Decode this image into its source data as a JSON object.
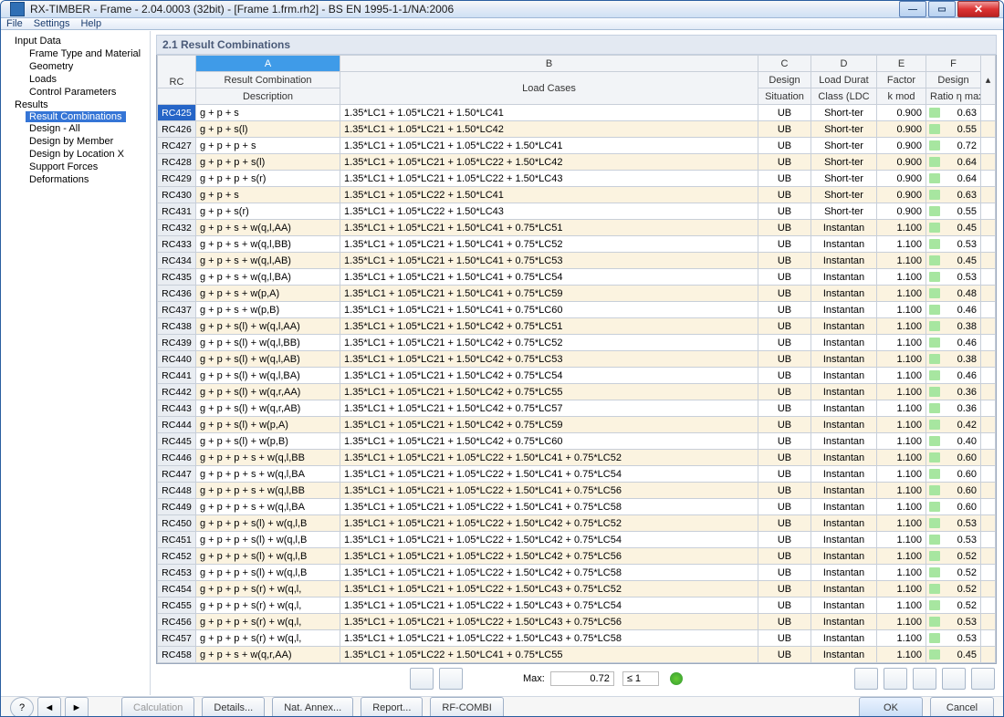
{
  "window": {
    "title": "RX-TIMBER - Frame - 2.04.0003 (32bit) - [Frame 1.frm.rh2] - BS EN 1995-1-1/NA:2006"
  },
  "menu": [
    "File",
    "Settings",
    "Help"
  ],
  "tree": {
    "input": "Input Data",
    "input_items": [
      "Frame Type and Material",
      "Geometry",
      "Loads",
      "Control Parameters"
    ],
    "results": "Results",
    "results_items": [
      "Result Combinations",
      "Design - All",
      "Design by Member",
      "Design by Location X",
      "Support Forces",
      "Deformations"
    ],
    "selected": "Result Combinations"
  },
  "panel": {
    "title": "2.1 Result Combinations",
    "colgroups": [
      "A",
      "B",
      "C",
      "D",
      "E",
      "F"
    ],
    "heads": {
      "rc": "RC",
      "desc1": "Result Combination",
      "desc2": "Description",
      "lc": "Load Cases",
      "ds1": "Design",
      "ds2": "Situation",
      "ld1": "Load Durat",
      "ld2": "Class (LDC",
      "fk1": "Factor",
      "fk2": "k mod",
      "dr1": "Design",
      "dr2": "Ratio η max"
    }
  },
  "rows": [
    {
      "rc": "RC425",
      "d": "g + p + s",
      "lc": "1.35*LC1 + 1.05*LC21 + 1.50*LC41",
      "ds": "UB",
      "ld": "Short-ter",
      "f": "0.900",
      "r": "0.63"
    },
    {
      "rc": "RC426",
      "d": "g + p + s(l)",
      "lc": "1.35*LC1 + 1.05*LC21 + 1.50*LC42",
      "ds": "UB",
      "ld": "Short-ter",
      "f": "0.900",
      "r": "0.55"
    },
    {
      "rc": "RC427",
      "d": "g + p + p + s",
      "lc": "1.35*LC1 + 1.05*LC21 + 1.05*LC22 + 1.50*LC41",
      "ds": "UB",
      "ld": "Short-ter",
      "f": "0.900",
      "r": "0.72"
    },
    {
      "rc": "RC428",
      "d": "g + p + p + s(l)",
      "lc": "1.35*LC1 + 1.05*LC21 + 1.05*LC22 + 1.50*LC42",
      "ds": "UB",
      "ld": "Short-ter",
      "f": "0.900",
      "r": "0.64"
    },
    {
      "rc": "RC429",
      "d": "g + p + p + s(r)",
      "lc": "1.35*LC1 + 1.05*LC21 + 1.05*LC22 + 1.50*LC43",
      "ds": "UB",
      "ld": "Short-ter",
      "f": "0.900",
      "r": "0.64"
    },
    {
      "rc": "RC430",
      "d": "g + p + s",
      "lc": "1.35*LC1 + 1.05*LC22 + 1.50*LC41",
      "ds": "UB",
      "ld": "Short-ter",
      "f": "0.900",
      "r": "0.63"
    },
    {
      "rc": "RC431",
      "d": "g + p + s(r)",
      "lc": "1.35*LC1 + 1.05*LC22 + 1.50*LC43",
      "ds": "UB",
      "ld": "Short-ter",
      "f": "0.900",
      "r": "0.55"
    },
    {
      "rc": "RC432",
      "d": "g + p + s + w(q,l,AA)",
      "lc": "1.35*LC1 + 1.05*LC21 + 1.50*LC41 + 0.75*LC51",
      "ds": "UB",
      "ld": "Instantan",
      "f": "1.100",
      "r": "0.45"
    },
    {
      "rc": "RC433",
      "d": "g + p + s + w(q,l,BB)",
      "lc": "1.35*LC1 + 1.05*LC21 + 1.50*LC41 + 0.75*LC52",
      "ds": "UB",
      "ld": "Instantan",
      "f": "1.100",
      "r": "0.53"
    },
    {
      "rc": "RC434",
      "d": "g + p + s + w(q,l,AB)",
      "lc": "1.35*LC1 + 1.05*LC21 + 1.50*LC41 + 0.75*LC53",
      "ds": "UB",
      "ld": "Instantan",
      "f": "1.100",
      "r": "0.45"
    },
    {
      "rc": "RC435",
      "d": "g + p + s + w(q,l,BA)",
      "lc": "1.35*LC1 + 1.05*LC21 + 1.50*LC41 + 0.75*LC54",
      "ds": "UB",
      "ld": "Instantan",
      "f": "1.100",
      "r": "0.53"
    },
    {
      "rc": "RC436",
      "d": "g + p + s + w(p,A)",
      "lc": "1.35*LC1 + 1.05*LC21 + 1.50*LC41 + 0.75*LC59",
      "ds": "UB",
      "ld": "Instantan",
      "f": "1.100",
      "r": "0.48"
    },
    {
      "rc": "RC437",
      "d": "g + p + s + w(p,B)",
      "lc": "1.35*LC1 + 1.05*LC21 + 1.50*LC41 + 0.75*LC60",
      "ds": "UB",
      "ld": "Instantan",
      "f": "1.100",
      "r": "0.46"
    },
    {
      "rc": "RC438",
      "d": "g + p + s(l) + w(q,l,AA)",
      "lc": "1.35*LC1 + 1.05*LC21 + 1.50*LC42 + 0.75*LC51",
      "ds": "UB",
      "ld": "Instantan",
      "f": "1.100",
      "r": "0.38"
    },
    {
      "rc": "RC439",
      "d": "g + p + s(l) + w(q,l,BB)",
      "lc": "1.35*LC1 + 1.05*LC21 + 1.50*LC42 + 0.75*LC52",
      "ds": "UB",
      "ld": "Instantan",
      "f": "1.100",
      "r": "0.46"
    },
    {
      "rc": "RC440",
      "d": "g + p + s(l) + w(q,l,AB)",
      "lc": "1.35*LC1 + 1.05*LC21 + 1.50*LC42 + 0.75*LC53",
      "ds": "UB",
      "ld": "Instantan",
      "f": "1.100",
      "r": "0.38"
    },
    {
      "rc": "RC441",
      "d": "g + p + s(l) + w(q,l,BA)",
      "lc": "1.35*LC1 + 1.05*LC21 + 1.50*LC42 + 0.75*LC54",
      "ds": "UB",
      "ld": "Instantan",
      "f": "1.100",
      "r": "0.46"
    },
    {
      "rc": "RC442",
      "d": "g + p + s(l) + w(q,r,AA)",
      "lc": "1.35*LC1 + 1.05*LC21 + 1.50*LC42 + 0.75*LC55",
      "ds": "UB",
      "ld": "Instantan",
      "f": "1.100",
      "r": "0.36"
    },
    {
      "rc": "RC443",
      "d": "g + p + s(l) + w(q,r,AB)",
      "lc": "1.35*LC1 + 1.05*LC21 + 1.50*LC42 + 0.75*LC57",
      "ds": "UB",
      "ld": "Instantan",
      "f": "1.100",
      "r": "0.36"
    },
    {
      "rc": "RC444",
      "d": "g + p + s(l) + w(p,A)",
      "lc": "1.35*LC1 + 1.05*LC21 + 1.50*LC42 + 0.75*LC59",
      "ds": "UB",
      "ld": "Instantan",
      "f": "1.100",
      "r": "0.42"
    },
    {
      "rc": "RC445",
      "d": "g + p + s(l) + w(p,B)",
      "lc": "1.35*LC1 + 1.05*LC21 + 1.50*LC42 + 0.75*LC60",
      "ds": "UB",
      "ld": "Instantan",
      "f": "1.100",
      "r": "0.40"
    },
    {
      "rc": "RC446",
      "d": "g + p + p + s + w(q,l,BB",
      "lc": "1.35*LC1 + 1.05*LC21 + 1.05*LC22 + 1.50*LC41 + 0.75*LC52",
      "ds": "UB",
      "ld": "Instantan",
      "f": "1.100",
      "r": "0.60"
    },
    {
      "rc": "RC447",
      "d": "g + p + p + s + w(q,l,BA",
      "lc": "1.35*LC1 + 1.05*LC21 + 1.05*LC22 + 1.50*LC41 + 0.75*LC54",
      "ds": "UB",
      "ld": "Instantan",
      "f": "1.100",
      "r": "0.60"
    },
    {
      "rc": "RC448",
      "d": "g + p + p + s + w(q,l,BB",
      "lc": "1.35*LC1 + 1.05*LC21 + 1.05*LC22 + 1.50*LC41 + 0.75*LC56",
      "ds": "UB",
      "ld": "Instantan",
      "f": "1.100",
      "r": "0.60"
    },
    {
      "rc": "RC449",
      "d": "g + p + p + s + w(q,l,BA",
      "lc": "1.35*LC1 + 1.05*LC21 + 1.05*LC22 + 1.50*LC41 + 0.75*LC58",
      "ds": "UB",
      "ld": "Instantan",
      "f": "1.100",
      "r": "0.60"
    },
    {
      "rc": "RC450",
      "d": "g + p + p + s(l) + w(q,l,B",
      "lc": "1.35*LC1 + 1.05*LC21 + 1.05*LC22 + 1.50*LC42 + 0.75*LC52",
      "ds": "UB",
      "ld": "Instantan",
      "f": "1.100",
      "r": "0.53"
    },
    {
      "rc": "RC451",
      "d": "g + p + p + s(l) + w(q,l,B",
      "lc": "1.35*LC1 + 1.05*LC21 + 1.05*LC22 + 1.50*LC42 + 0.75*LC54",
      "ds": "UB",
      "ld": "Instantan",
      "f": "1.100",
      "r": "0.53"
    },
    {
      "rc": "RC452",
      "d": "g + p + p + s(l) + w(q,l,B",
      "lc": "1.35*LC1 + 1.05*LC21 + 1.05*LC22 + 1.50*LC42 + 0.75*LC56",
      "ds": "UB",
      "ld": "Instantan",
      "f": "1.100",
      "r": "0.52"
    },
    {
      "rc": "RC453",
      "d": "g + p + p + s(l) + w(q,l,B",
      "lc": "1.35*LC1 + 1.05*LC21 + 1.05*LC22 + 1.50*LC42 + 0.75*LC58",
      "ds": "UB",
      "ld": "Instantan",
      "f": "1.100",
      "r": "0.52"
    },
    {
      "rc": "RC454",
      "d": "g + p + p + s(r) + w(q,l,",
      "lc": "1.35*LC1 + 1.05*LC21 + 1.05*LC22 + 1.50*LC43 + 0.75*LC52",
      "ds": "UB",
      "ld": "Instantan",
      "f": "1.100",
      "r": "0.52"
    },
    {
      "rc": "RC455",
      "d": "g + p + p + s(r) + w(q,l,",
      "lc": "1.35*LC1 + 1.05*LC21 + 1.05*LC22 + 1.50*LC43 + 0.75*LC54",
      "ds": "UB",
      "ld": "Instantan",
      "f": "1.100",
      "r": "0.52"
    },
    {
      "rc": "RC456",
      "d": "g + p + p + s(r) + w(q,l,",
      "lc": "1.35*LC1 + 1.05*LC21 + 1.05*LC22 + 1.50*LC43 + 0.75*LC56",
      "ds": "UB",
      "ld": "Instantan",
      "f": "1.100",
      "r": "0.53"
    },
    {
      "rc": "RC457",
      "d": "g + p + p + s(r) + w(q,l,",
      "lc": "1.35*LC1 + 1.05*LC21 + 1.05*LC22 + 1.50*LC43 + 0.75*LC58",
      "ds": "UB",
      "ld": "Instantan",
      "f": "1.100",
      "r": "0.53"
    },
    {
      "rc": "RC458",
      "d": "g + p + s + w(q,r,AA)",
      "lc": "1.35*LC1 + 1.05*LC22 + 1.50*LC41 + 0.75*LC55",
      "ds": "UB",
      "ld": "Instantan",
      "f": "1.100",
      "r": "0.45"
    }
  ],
  "maxbar": {
    "label": "Max:",
    "value": "0.72",
    "cond": "≤ 1"
  },
  "footer": {
    "calc": "Calculation",
    "details": "Details...",
    "annex": "Nat. Annex...",
    "report": "Report...",
    "combi": "RF-COMBI",
    "ok": "OK",
    "cancel": "Cancel"
  }
}
